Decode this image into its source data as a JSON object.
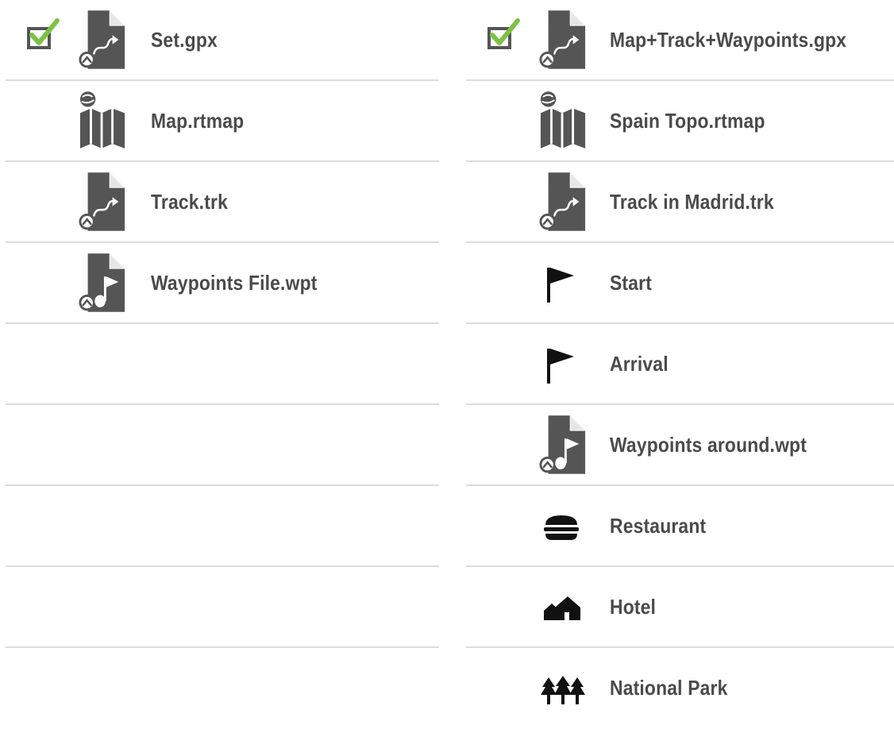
{
  "left_list": {
    "items": [
      {
        "label": "Set.gpx",
        "icon": "route-file-icon",
        "checked": true
      },
      {
        "label": "Map.rtmap",
        "icon": "map-file-icon",
        "checked": false
      },
      {
        "label": "Track.trk",
        "icon": "route-file-icon",
        "checked": false
      },
      {
        "label": "Waypoints File.wpt",
        "icon": "waypoints-file-icon",
        "checked": false
      }
    ]
  },
  "right_list": {
    "items": [
      {
        "label": "Map+Track+Waypoints.gpx",
        "icon": "route-file-icon",
        "checked": true
      },
      {
        "label": "Spain Topo.rtmap",
        "icon": "map-file-icon",
        "checked": false
      },
      {
        "label": "Track in Madrid.trk",
        "icon": "route-file-icon",
        "checked": false
      },
      {
        "label": "Start",
        "icon": "flag-icon",
        "checked": false
      },
      {
        "label": "Arrival",
        "icon": "flag-icon",
        "checked": false
      },
      {
        "label": "Waypoints around.wpt",
        "icon": "waypoints-file-icon",
        "checked": false
      },
      {
        "label": "Restaurant",
        "icon": "burger-icon",
        "checked": false
      },
      {
        "label": "Hotel",
        "icon": "houses-icon",
        "checked": false
      },
      {
        "label": "National Park",
        "icon": "trees-icon",
        "checked": false
      }
    ]
  },
  "colors": {
    "text": "#4a4a4a",
    "icon_fill": "#555555",
    "check_green": "#7dc242",
    "divider": "#dcdcdc"
  }
}
